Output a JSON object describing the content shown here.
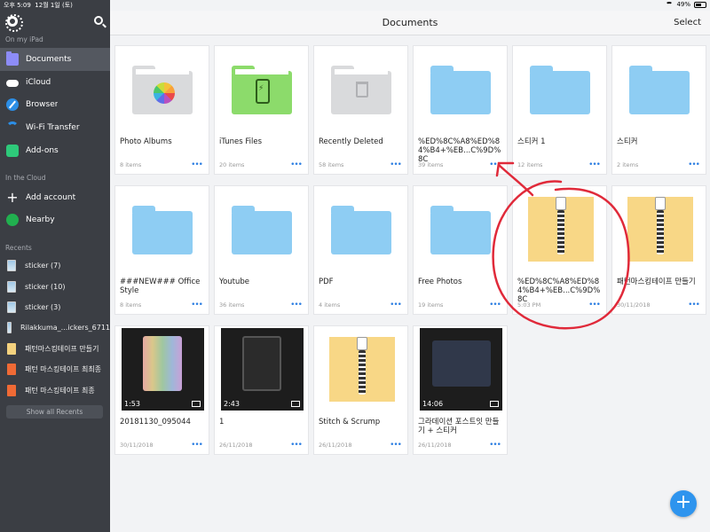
{
  "status_bar": {
    "time": "오후 5:09",
    "date": "12월 1일 (토)",
    "battery": "49%"
  },
  "main": {
    "title": "Documents",
    "select_label": "Select",
    "fab_label": "+"
  },
  "sidebar": {
    "sections": {
      "on_my_ipad": "On my iPad",
      "in_the_cloud": "In the Cloud",
      "recents": "Recents"
    },
    "items": [
      {
        "label": "Documents",
        "icon": "folder-icon"
      },
      {
        "label": "iCloud",
        "icon": "cloud-icon"
      },
      {
        "label": "Browser",
        "icon": "compass-icon"
      },
      {
        "label": "Wi-Fi Transfer",
        "icon": "wifi-icon"
      },
      {
        "label": "Add-ons",
        "icon": "addons-icon"
      },
      {
        "label": "Add account",
        "icon": "plus-icon"
      },
      {
        "label": "Nearby",
        "icon": "nearby-icon"
      }
    ],
    "recents": [
      {
        "label": "sticker (7)"
      },
      {
        "label": "sticker (10)"
      },
      {
        "label": "sticker (3)"
      },
      {
        "label": "Rilakkuma_...ickers_6711"
      },
      {
        "label": "패턴마스킹테이프 만들기"
      },
      {
        "label": "패턴 마스킹테이프 최최종"
      },
      {
        "label": "패턴 마스킹테이프 최종"
      }
    ],
    "show_all_recents": "Show all Recents"
  },
  "files": [
    {
      "name": "Photo Albums",
      "meta": "8 items"
    },
    {
      "name": "iTunes Files",
      "meta": "20 items"
    },
    {
      "name": "Recently Deleted",
      "meta": "58 items"
    },
    {
      "name": "%ED%8C%A8%ED%84%B4+%EB...C%9D%8C",
      "meta": "39 items"
    },
    {
      "name": "스티커 1",
      "meta": "12 items"
    },
    {
      "name": "스티커",
      "meta": "2 items"
    },
    {
      "name": "###NEW### Office Style",
      "meta": "8 items"
    },
    {
      "name": "Youtube",
      "meta": "36 items"
    },
    {
      "name": "PDF",
      "meta": "4 items"
    },
    {
      "name": "Free Photos",
      "meta": "19 items"
    },
    {
      "name": "%ED%8C%A8%ED%84%B4+%EB...C%9D%8C",
      "meta": "5:03 PM"
    },
    {
      "name": "패턴마스킹테이프 만들기",
      "meta": "30/11/2018"
    },
    {
      "name": "20181130_095044",
      "meta": "30/11/2018",
      "duration": "1:53"
    },
    {
      "name": "1",
      "meta": "26/11/2018",
      "duration": "2:43"
    },
    {
      "name": "Stitch & Scrump",
      "meta": "26/11/2018"
    },
    {
      "name": "그라데이션 포스트잇 만들기 + 스티커",
      "meta": "26/11/2018",
      "duration": "14:06"
    }
  ],
  "more_dots": "•••"
}
